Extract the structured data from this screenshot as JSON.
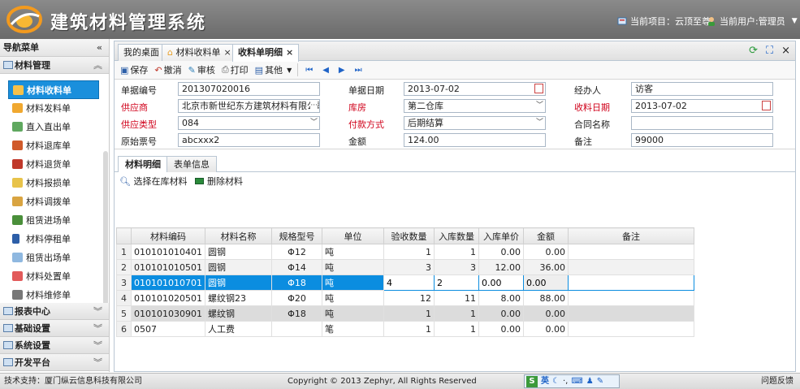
{
  "header": {
    "title": "建筑材料管理系统",
    "project_label": "当前项目：云顶至尊",
    "user_label": "当前用户:管理员"
  },
  "sidebar": {
    "title": "导航菜单",
    "group_material": "材料管理",
    "items": [
      {
        "label": "材料收料单"
      },
      {
        "label": "材料发料单"
      },
      {
        "label": "直入直出单"
      },
      {
        "label": "材料退库单"
      },
      {
        "label": "材料退货单"
      },
      {
        "label": "材料报损单"
      },
      {
        "label": "材料调拨单"
      },
      {
        "label": "租赁进场单"
      },
      {
        "label": "材料停租单"
      },
      {
        "label": "租赁出场单"
      },
      {
        "label": "材料处置单"
      },
      {
        "label": "材料维修单"
      }
    ],
    "groups": [
      {
        "label": "报表中心"
      },
      {
        "label": "基础设置"
      },
      {
        "label": "系统设置"
      },
      {
        "label": "开发平台"
      }
    ]
  },
  "tabs": [
    {
      "label": "我的桌面"
    },
    {
      "label": "材料收料单"
    },
    {
      "label": "收料单明细"
    }
  ],
  "toolbar": {
    "save": "保存",
    "cancel": "撤消",
    "audit": "审核",
    "print": "打印",
    "other": "其他"
  },
  "form": {
    "doc_no_label": "单据编号",
    "doc_no": "201307020016",
    "doc_date_label": "单据日期",
    "doc_date": "2013-07-02",
    "handler_label": "经办人",
    "handler": "访客",
    "supplier_label": "供应商",
    "supplier": "北京市新世纪东方建筑材料有限公司",
    "warehouse_label": "库房",
    "warehouse": "第二仓库",
    "receive_date_label": "收料日期",
    "receive_date": "2013-07-02",
    "supply_type_label": "供应类型",
    "supply_type": "084",
    "payment_label": "付款方式",
    "payment": "后期结算",
    "contract_label": "合同名称",
    "contract": "",
    "ticket_label": "原始票号",
    "ticket": "abcxxx2",
    "amount_label": "金额",
    "amount": "124.00",
    "remark_label": "备注",
    "remark": "99000"
  },
  "subtabs": [
    {
      "label": "材料明细"
    },
    {
      "label": "表单信息"
    }
  ],
  "gridtools": {
    "select": "选择在库材料",
    "delete": "删除材料"
  },
  "grid": {
    "headers": [
      "材料编码",
      "材料名称",
      "规格型号",
      "单位",
      "验收数量",
      "入库数量",
      "入库单价",
      "金额",
      "备注"
    ],
    "rows": [
      {
        "n": "1",
        "code": "010101010401",
        "name": "圆钢",
        "spec": "Φ12",
        "unit": "吨",
        "acc": "1",
        "inq": "1",
        "price": "0.00",
        "amt": "0.00",
        "note": ""
      },
      {
        "n": "2",
        "code": "010101010501",
        "name": "圆钢",
        "spec": "Φ14",
        "unit": "吨",
        "acc": "3",
        "inq": "3",
        "price": "12.00",
        "amt": "36.00",
        "note": ""
      },
      {
        "n": "3",
        "code": "010101010701",
        "name": "圆钢",
        "spec": "Φ18",
        "unit": "吨",
        "acc": "4",
        "inq": "2",
        "price": "0.00",
        "amt": "0.00",
        "note": ""
      },
      {
        "n": "4",
        "code": "010101020501",
        "name": "螺纹钢23",
        "spec": "Φ20",
        "unit": "吨",
        "acc": "12",
        "inq": "11",
        "price": "8.00",
        "amt": "88.00",
        "note": ""
      },
      {
        "n": "5",
        "code": "010101030901",
        "name": "螺纹钢",
        "spec": "Φ18",
        "unit": "吨",
        "acc": "1",
        "inq": "1",
        "price": "0.00",
        "amt": "0.00",
        "note": ""
      },
      {
        "n": "6",
        "code": "0507",
        "name": "人工费",
        "spec": "",
        "unit": "笔",
        "acc": "1",
        "inq": "1",
        "price": "0.00",
        "amt": "0.00",
        "note": ""
      }
    ]
  },
  "footer": {
    "support": "技术支持：厦门纵云信息科技有限公司",
    "copyright": "Copyright © 2013 Zephyr, All Rights Reserved",
    "ime_label": "英",
    "feedback": "问题反馈"
  }
}
